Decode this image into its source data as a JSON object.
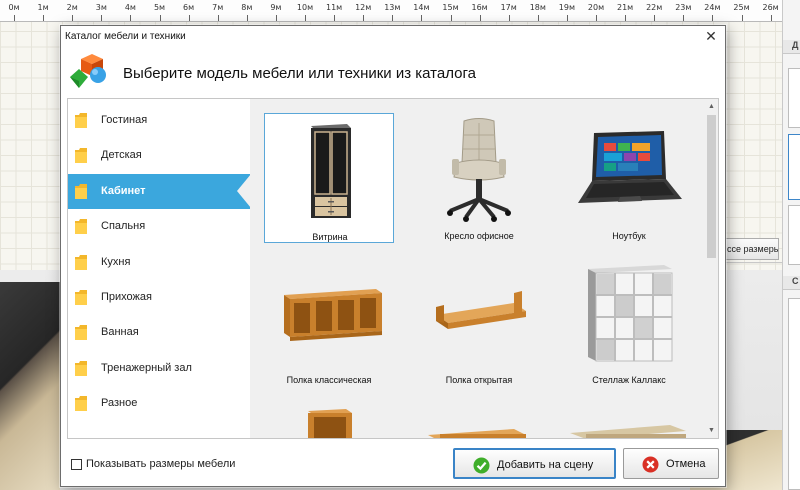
{
  "ruler": {
    "labels": [
      "0м",
      "1м",
      "2м",
      "3м",
      "4м",
      "5м",
      "6м",
      "7м",
      "8м",
      "9м",
      "10м",
      "11м",
      "12м",
      "13м",
      "14м",
      "15м",
      "16м",
      "17м",
      "18м",
      "19м",
      "20м",
      "21м",
      "22м",
      "23м",
      "24м",
      "25м",
      "26м"
    ]
  },
  "background": {
    "sizes_button_label": "ссе размеры",
    "panel_head_1": "Д",
    "panel_head_2": "С"
  },
  "dialog": {
    "title": "Каталог мебели и техники",
    "close_glyph": "✕",
    "heading": "Выберите модель мебели или техники из каталога"
  },
  "categories": [
    {
      "label": "Гостиная"
    },
    {
      "label": "Детская"
    },
    {
      "label": "Кабинет"
    },
    {
      "label": "Спальня"
    },
    {
      "label": "Кухня"
    },
    {
      "label": "Прихожая"
    },
    {
      "label": "Ванная"
    },
    {
      "label": "Тренажерный зал"
    },
    {
      "label": "Разное"
    }
  ],
  "active_category": "Кабинет",
  "items": [
    {
      "label": "Витрина",
      "icon": "display-cabinet-icon",
      "selected": true
    },
    {
      "label": "Кресло офисное",
      "icon": "office-chair-icon",
      "selected": false
    },
    {
      "label": "Ноутбук",
      "icon": "laptop-icon",
      "selected": false
    },
    {
      "label": "Полка классическая",
      "icon": "classic-shelf-icon",
      "selected": false
    },
    {
      "label": "Полка открытая",
      "icon": "open-shelf-icon",
      "selected": false
    },
    {
      "label": "Стеллаж Каллакс",
      "icon": "kallax-rack-icon",
      "selected": false
    }
  ],
  "scroll": {
    "up_glyph": "▲",
    "down_glyph": "▼"
  },
  "footer": {
    "show_sizes_label": "Показывать размеры мебели",
    "show_sizes_checked": false,
    "add_button_label": "Добавить на сцену",
    "cancel_button_label": "Отмена"
  },
  "colors": {
    "accent": "#3ba7dd",
    "selection_border": "#5aa7d8",
    "primary_button_border": "#3a84c7",
    "add_icon": "#3fae2a",
    "cancel_icon": "#d93025"
  }
}
